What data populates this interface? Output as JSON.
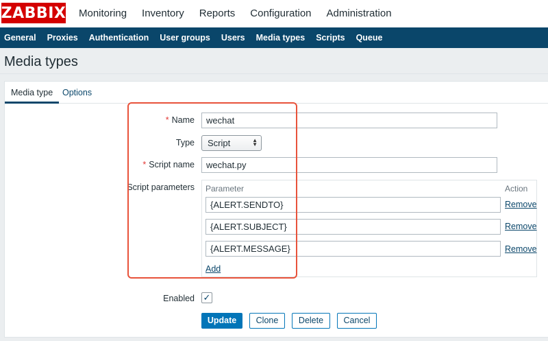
{
  "brand": {
    "logo_text": "ZABBIX",
    "color": "#d40000"
  },
  "main_menu": [
    "Monitoring",
    "Inventory",
    "Reports",
    "Configuration",
    "Administration"
  ],
  "main_menu_active": "Administration",
  "sub_menu": [
    "General",
    "Proxies",
    "Authentication",
    "User groups",
    "Users",
    "Media types",
    "Scripts",
    "Queue"
  ],
  "sub_menu_active": "Media types",
  "page": {
    "title": "Media types"
  },
  "tabs": {
    "active": "Media type",
    "inactive": "Options"
  },
  "form": {
    "name_label": "Name",
    "name_value": "wechat",
    "type_label": "Type",
    "type_value": "Script",
    "script_name_label": "Script name",
    "script_name_value": "wechat.py",
    "params_label": "Script parameters",
    "param_col": "Parameter",
    "action_col": "Action",
    "params": [
      "{ALERT.SENDTO}",
      "{ALERT.SUBJECT}",
      "{ALERT.MESSAGE}"
    ],
    "remove_label": "Remove",
    "add_label": "Add",
    "enabled_label": "Enabled",
    "enabled_checked": true,
    "required_mark": "*"
  },
  "buttons": {
    "update": "Update",
    "clone": "Clone",
    "delete": "Delete",
    "cancel": "Cancel"
  },
  "colors": {
    "nav": "#0a466a",
    "accent": "#0275b8",
    "highlight": "#e8523a"
  }
}
